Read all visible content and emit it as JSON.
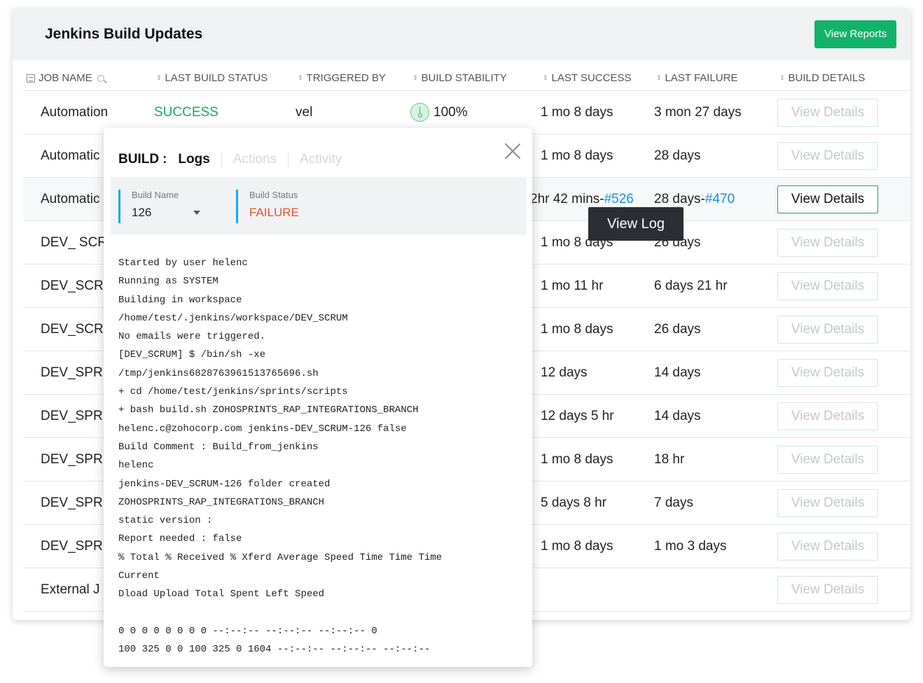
{
  "header": {
    "title": "Jenkins Build Updates",
    "view_reports": "View Reports"
  },
  "columns": {
    "job_name": "JOB NAME",
    "last_build_status": "LAST BUILD STATUS",
    "triggered_by": "TRIGGERED BY",
    "build_stability": "BUILD STABILITY",
    "last_success": "LAST SUCCESS",
    "last_failure": "LAST FAILURE",
    "build_details": "BUILD DETAILS"
  },
  "rows": [
    {
      "job": "Automation",
      "status": "SUCCESS",
      "triggered": "vel",
      "stability": "100%",
      "last_success": "1 mo 8 days",
      "last_success_link": "",
      "last_failure": "3 mon 27 days",
      "last_failure_link": "",
      "details": "View Details"
    },
    {
      "job": "Automatic",
      "status": "",
      "triggered": "",
      "stability": "",
      "last_success": "1 mo 8 days",
      "last_success_link": "",
      "last_failure": "28 days",
      "last_failure_link": "",
      "details": "View Details"
    },
    {
      "job": "Automatic",
      "status": "",
      "triggered": "",
      "stability": "",
      "last_success": "2hr 42 mins-",
      "last_success_link": "#526",
      "last_failure": "28 days-",
      "last_failure_link": "#470",
      "details": "View Details"
    },
    {
      "job": "DEV_ SCR",
      "status": "",
      "triggered": "",
      "stability": "",
      "last_success": "1 mo 8 days",
      "last_success_link": "",
      "last_failure": "26 days",
      "last_failure_link": "",
      "details": "View Details"
    },
    {
      "job": "DEV_SCRU",
      "status": "",
      "triggered": "",
      "stability": "",
      "last_success": "1 mo 11 hr",
      "last_success_link": "",
      "last_failure": "6 days 21 hr",
      "last_failure_link": "",
      "details": "View Details"
    },
    {
      "job": "DEV_SCRU",
      "status": "",
      "triggered": "",
      "stability": "",
      "last_success": "1 mo 8 days",
      "last_success_link": "",
      "last_failure": "26 days",
      "last_failure_link": "",
      "details": "View Details"
    },
    {
      "job": "DEV_SPRI",
      "status": "",
      "triggered": "",
      "stability": "",
      "last_success": "12 days",
      "last_success_link": "",
      "last_failure": "14 days",
      "last_failure_link": "",
      "details": "View Details"
    },
    {
      "job": "DEV_SPRI",
      "status": "",
      "triggered": "",
      "stability": "",
      "last_success": "12 days 5 hr",
      "last_success_link": "",
      "last_failure": "14 days",
      "last_failure_link": "",
      "details": "View Details"
    },
    {
      "job": "DEV_SPRI",
      "status": "",
      "triggered": "",
      "stability": "",
      "last_success": "1 mo 8 days",
      "last_success_link": "",
      "last_failure": "18 hr",
      "last_failure_link": "",
      "details": "View Details"
    },
    {
      "job": "DEV_SPRI",
      "status": "",
      "triggered": "",
      "stability": "",
      "last_success": "5 days 8 hr",
      "last_success_link": "",
      "last_failure": "7 days",
      "last_failure_link": "",
      "details": "View Details"
    },
    {
      "job": "DEV_SPRI",
      "status": "",
      "triggered": "",
      "stability": "",
      "last_success": "1 mo 8 days",
      "last_success_link": "",
      "last_failure": "1 mo 3 days",
      "last_failure_link": "",
      "details": "View Details"
    },
    {
      "job": "External J",
      "status": "",
      "triggered": "",
      "stability": "",
      "last_success": "",
      "last_success_link": "",
      "last_failure": "",
      "last_failure_link": "",
      "details": "View Details"
    }
  ],
  "tooltip": "View Log",
  "popup": {
    "prefix": "BUILD",
    "colon": ":",
    "tabs": [
      "Logs",
      "Actions",
      "Activity"
    ],
    "build_name_label": "Build Name",
    "build_name_value": "126",
    "build_status_label": "Build Status",
    "build_status_value": "FAILURE",
    "log_lines": [
      "Started by user helenc",
      "Running as SYSTEM",
      "Building in workspace",
      "/home/test/.jenkins/workspace/DEV_SCRUM",
      "No emails were triggered.",
      "[DEV_SCRUM] $ /bin/sh -xe",
      "/tmp/jenkins6828763961513765696.sh",
      "+ cd /home/test/jenkins/sprints/scripts",
      "+ bash build.sh ZOHOSPRINTS_RAP_INTEGRATIONS_BRANCH",
      "helenc.c@zohocorp.com jenkins-DEV_SCRUM-126 false",
      "Build Comment : Build_from_jenkins",
      "helenc",
      "jenkins-DEV_SCRUM-126 folder created",
      "ZOHOSPRINTS_RAP_INTEGRATIONS_BRANCH",
      "static version :",
      "Report needed : false",
      "% Total % Received % Xferd Average Speed Time Time Time",
      "Current",
      "Dload Upload Total Spent Left Speed",
      "",
      "0 0 0 0 0 0 0 0 --:--:-- --:--:-- --:--:-- 0",
      "100 325 0 0 100 325 0 1604 --:--:-- --:--:-- --:--:--"
    ]
  },
  "colors": {
    "accent_green": "#13b26b",
    "success_text": "#19a866",
    "failure_text": "#e2512d",
    "link_blue": "#1a8fd6",
    "info_border": "#1aa7e8"
  }
}
